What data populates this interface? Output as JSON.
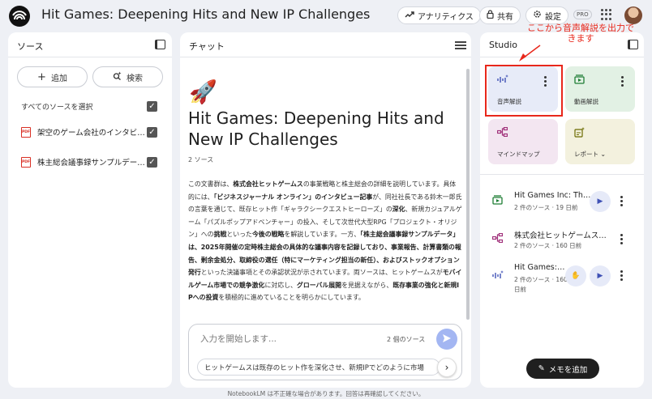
{
  "header": {
    "title": "Hit Games: Deepening Hits and New IP Challenges",
    "analytics": "アナリティクス",
    "share": "共有",
    "settings": "設定",
    "pro_badge": "PRO"
  },
  "sources": {
    "title": "ソース",
    "add": "追加",
    "search": "検索",
    "select_all": "すべてのソースを選択",
    "items": [
      {
        "label": "架空のゲーム会社のインタビ…",
        "icon": "pdf-icon"
      },
      {
        "label": "株主総会議事録サンプルデー…",
        "icon": "pdf-icon"
      }
    ]
  },
  "chat": {
    "title": "チャット",
    "notebook_title": "Hit Games: Deepening Hits and New IP Challenges",
    "source_count": "2 ソース",
    "summary": [
      {
        "t": "この文書群は、",
        "b": false
      },
      {
        "t": "株式会社ヒットゲームス",
        "b": true
      },
      {
        "t": "の事業戦略と株主総会の詳細を説明しています。具体的には、",
        "b": false
      },
      {
        "t": "「ビジネスジャーナル オンライン」のインタビュー記事",
        "b": true
      },
      {
        "t": "が、同社社長である鈴木一郎氏の言葉を通じて、既存ヒット作「ギャラクシークエストヒーローズ」の",
        "b": false
      },
      {
        "t": "深化",
        "b": true
      },
      {
        "t": "、新規カジュアルゲーム「パズルポップアドベンチャー」の投入、そして次世代大型RPG「プロジェクト・オリジン」への",
        "b": false
      },
      {
        "t": "挑戦",
        "b": true
      },
      {
        "t": "といった",
        "b": false
      },
      {
        "t": "今後の戦略",
        "b": true
      },
      {
        "t": "を解説しています。一方、",
        "b": false
      },
      {
        "t": "「株主総会議事録サンプルデータ」は、2025年開催の定時株主総会の具体的な議事内容を記録しており、事業報告、計算書類の報告、剰余金処分、取締役の選任（特にマーケティング担当の新任）、およびストックオプション発行",
        "b": true
      },
      {
        "t": "といった決議事項とその承認状況が示されています。両ソースは、ヒットゲームスが",
        "b": false
      },
      {
        "t": "モバイルゲーム市場での競争激化",
        "b": true
      },
      {
        "t": "に対応し、",
        "b": false
      },
      {
        "t": "グローバル展開",
        "b": true
      },
      {
        "t": "を見据えながら、",
        "b": false
      },
      {
        "t": "既存事業の強化と新規IPへの投資",
        "b": true
      },
      {
        "t": "を積極的に進めていることを明らかにしています。",
        "b": false
      }
    ],
    "input_placeholder": "入力を開始します...",
    "input_source_count": "2 個のソース",
    "suggestion": "ヒットゲームスは既存のヒット作を深化させ、新規IPでどのように市場"
  },
  "studio": {
    "title": "Studio",
    "tiles": [
      {
        "label": "音声解説",
        "icon": "audio-overview-icon",
        "color": "#e7ebf8"
      },
      {
        "label": "動画解説",
        "icon": "video-overview-icon",
        "color": "#e2f1e4"
      },
      {
        "label": "マインドマップ",
        "icon": "mind-map-icon",
        "color": "#f3e6f1"
      },
      {
        "label": "レポート",
        "icon": "report-icon",
        "color": "#f3f1de"
      }
    ],
    "notes": [
      {
        "title": "Hit Games Inc: Th…",
        "meta": "2 件のソース · 19 日前",
        "icon": "video-overview-icon",
        "color": "#1e7e34"
      },
      {
        "title": "株式会社ヒットゲームス…",
        "meta": "2 件のソース · 160 日前",
        "icon": "mind-map-icon",
        "color": "#a0307a"
      },
      {
        "title": "Hit Games:…",
        "meta": "2 件のソース · 160 日前",
        "icon": "audio-overview-icon",
        "color": "#3f51b5"
      }
    ],
    "add_note": "メモを追加"
  },
  "annotation": "ここから音声解説を出力できます",
  "footer": "NotebookLM は不正確な場合があります。回答は再確認してください。",
  "colors": {
    "annotation_red": "#e8271b",
    "accent": "#3f51b5"
  }
}
